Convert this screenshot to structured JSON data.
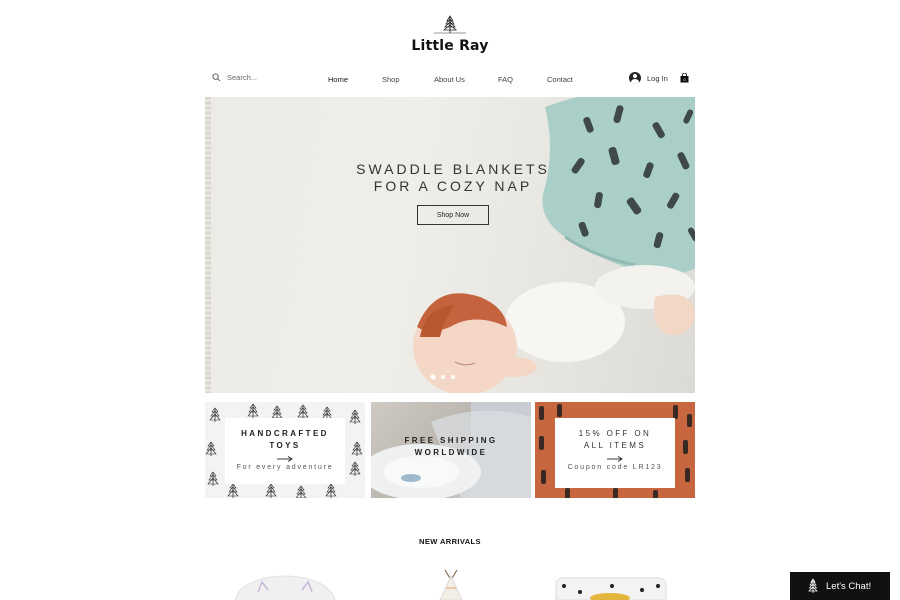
{
  "brand": {
    "name": "Little Ray",
    "logo_icon": "pine-tree-icon"
  },
  "search": {
    "placeholder": "Search...",
    "icon": "search-icon"
  },
  "nav": {
    "items": [
      {
        "label": "Home",
        "active": true
      },
      {
        "label": "Shop",
        "active": false
      },
      {
        "label": "About Us",
        "active": false
      },
      {
        "label": "FAQ",
        "active": false
      },
      {
        "label": "Contact",
        "active": false
      }
    ],
    "login_label": "Log In",
    "cart_count": "0"
  },
  "hero": {
    "title_line1": "SWADDLE BLANKETS",
    "title_line2": "FOR A COZY NAP",
    "cta_label": "Shop Now",
    "slide_count": 3,
    "active_slide": 1
  },
  "promos": [
    {
      "title_line1": "HANDCRAFTED",
      "title_line2": "TOYS",
      "subtitle": "For every adventure"
    },
    {
      "title_line1": "FREE SHIPPING",
      "title_line2": "WORLDWIDE"
    },
    {
      "title_line1": "15% OFF ON",
      "title_line2": "ALL ITEMS",
      "subtitle": "Coupon code LR123"
    }
  ],
  "new_arrivals": {
    "title": "NEW ARRIVALS"
  },
  "chat": {
    "label": "Let's Chat!"
  },
  "colors": {
    "accent_dark": "#111111",
    "promo_orange": "#c8673f",
    "blanket_mint": "#a9cfc8"
  }
}
